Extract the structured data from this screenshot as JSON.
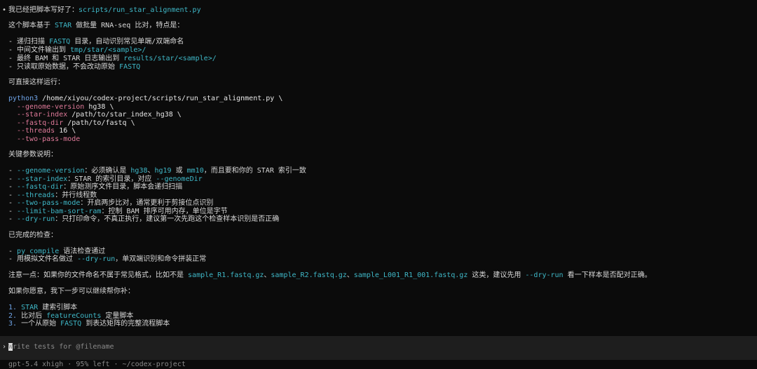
{
  "messages": {
    "intro_prefix": "我已经把脚本写好了：",
    "intro_path": "scripts/run_star_alignment.py",
    "desc_a": "这个脚本基于 ",
    "desc_star": "STAR",
    "desc_b": " 做批量 RNA-seq 比对，特点是：",
    "f1_a": "- 递归扫描 ",
    "f1_fastq": "FASTQ",
    "f1_b": " 目录，自动识别常见单端/双端命名",
    "f2_a": "- 中间文件输出到 ",
    "f2_path": "tmp/star/<sample>/",
    "f3_a": "- 最终 BAM 和 STAR 日志输出到 ",
    "f3_path": "results/star/<sample>/",
    "f4_a": "- 只读取原始数据，不会改动原始 ",
    "f4_fastq": "FASTQ",
    "run_heading": "可直接这样运行：",
    "cmd_python": "python3",
    "cmd_script": " /home/xiyou/codex-project/scripts/run_star_alignment.py \\",
    "a1_flag": "--genome-version",
    "a1_val": " hg38 \\",
    "a2_flag": "--star-index",
    "a2_val": " /path/to/star_index_hg38 \\",
    "a3_flag": "--fastq-dir",
    "a3_val": " /path/to/fastq \\",
    "a4_flag": "--threads",
    "a4_val": " 16 \\",
    "a5_flag": "--two-pass-mode",
    "params_heading": "关键参数说明：",
    "p1_flag": "--genome-version",
    "p1_a": "：必须确认是 ",
    "p1_hg38": "hg38",
    "p1_sep1": "、",
    "p1_hg19": "hg19",
    "p1_or": " 或 ",
    "p1_mm10": "mm10",
    "p1_b": "，而且要和你的 STAR 索引一致",
    "p2_flag": "--star-index",
    "p2_a": "：STAR 的索引目录，对应 ",
    "p2_ref": "--genomeDir",
    "p3_flag": "--fastq-dir",
    "p3_a": "：原始测序文件目录，脚本会递归扫描",
    "p4_flag": "--threads",
    "p4_a": "：并行线程数",
    "p5_flag": "--two-pass-mode",
    "p5_a": "：开启两步比对，通常更利于剪接位点识别",
    "p6_flag": "--limit-bam-sort-ram",
    "p6_a": "：控制 BAM 排序可用内存，单位是字节",
    "p7_flag": "--dry-run",
    "p7_a": "：只打印命令，不真正执行，建议第一次先跑这个检查样本识别是否正确",
    "checks_heading": "已完成的检查：",
    "c1_a": "- ",
    "c1_code": "py_compile",
    "c1_b": " 语法检查通过",
    "c2_a": "- 用模拟文件名做过 ",
    "c2_code": "--dry-run",
    "c2_b": "，单双端识别和命令拼装正常",
    "note_a": "注意一点：如果你的文件命名不属于常见格式，比如不是 ",
    "note_f1": "sample_R1.fastq.gz",
    "note_sep1": "、",
    "note_f2": "sample_R2.fastq.gz",
    "note_sep2": "、",
    "note_f3": "sample_L001_R1_001.fastq.gz",
    "note_b": " 这类，建议先用 ",
    "note_code": "--dry-run",
    "note_c": " 看一下样本是否配对正确。",
    "next_heading": "如果你愿意，我下一步可以继续帮你补：",
    "n1_num": "1.",
    "n1_code": "STAR",
    "n1_text": " 建索引脚本",
    "n2_num": "2.",
    "n2_a": " 比对后 ",
    "n2_code": "featureCounts",
    "n2_b": " 定量脚本",
    "n3_num": "3.",
    "n3_a": " 一个从原始 ",
    "n3_code": "FASTQ",
    "n3_b": " 到表达矩阵的完整流程脚本"
  },
  "composer": {
    "prompt_symbol": "›",
    "placeholder": "Write tests for @filename"
  },
  "statusbar": {
    "text": "gpt-5.4 xhigh · 95% left · ~/codex-project"
  },
  "bullet": "•",
  "colors": {
    "accent_cyan": "#3fb8c8",
    "flag_pink": "#e07a9a",
    "python_blue": "#6fa4e8"
  }
}
